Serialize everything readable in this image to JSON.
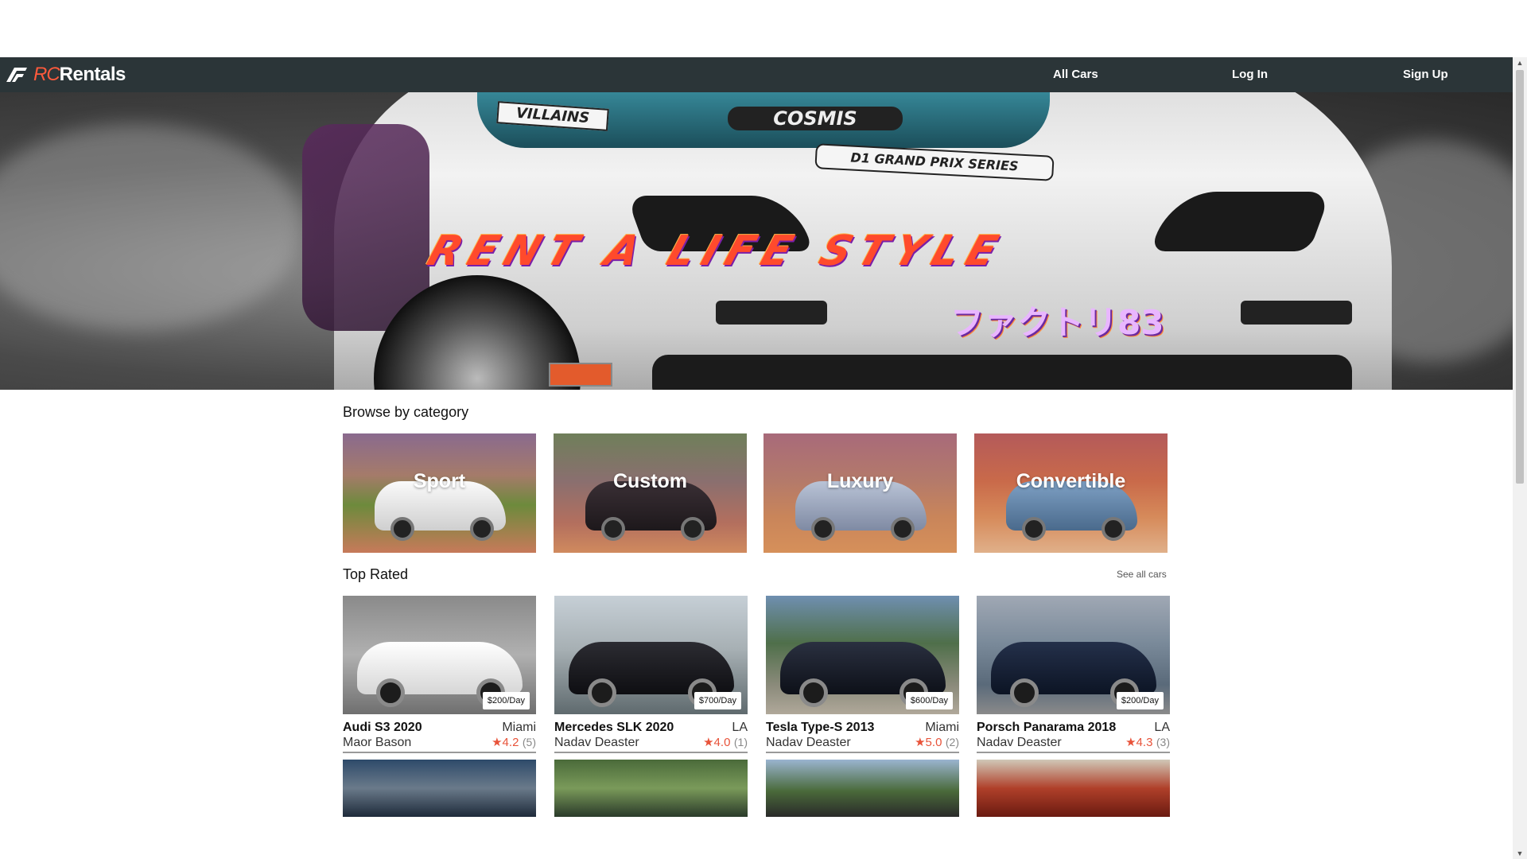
{
  "navbar": {
    "brand_rc": "RC",
    "brand_rentals": "Rentals",
    "links": [
      "All Cars",
      "Log In",
      "Sign Up"
    ],
    "background": "#2b3538",
    "accent": "#ff5a3c"
  },
  "hero": {
    "slogan": "RENT A LIFE STYLE",
    "decals": [
      "VILLAINS",
      "COSMIS",
      "D1 GRAND PRIX SERIES"
    ],
    "japanese_text": "ファクトリ83"
  },
  "browse": {
    "title": "Browse by category",
    "categories": [
      {
        "label": "Sport",
        "icon": "sport-car-photo"
      },
      {
        "label": "Custom",
        "icon": "custom-car-photo"
      },
      {
        "label": "Luxury",
        "icon": "luxury-car-photo"
      },
      {
        "label": "Convertible",
        "icon": "convertible-car-photo"
      }
    ]
  },
  "top_rated": {
    "title": "Top Rated",
    "see_all": "See all cars",
    "cars": [
      {
        "name": "Audi S3 2020",
        "city": "Miami",
        "owner": "Maor Bason",
        "rating": "★4.2",
        "count": "(5)",
        "price": "$200/Day"
      },
      {
        "name": "Mercedes SLK 2020",
        "city": "LA",
        "owner": "Nadav Deaster",
        "rating": "★4.0",
        "count": "(1)",
        "price": "$700/Day"
      },
      {
        "name": "Tesla Type-S 2013",
        "city": "Miami",
        "owner": "Nadav Deaster",
        "rating": "★5.0",
        "count": "(2)",
        "price": "$600/Day"
      },
      {
        "name": "Porsch Panarama 2018",
        "city": "LA",
        "owner": "Nadav Deaster",
        "rating": "★4.3",
        "count": "(3)",
        "price": "$200/Day"
      }
    ]
  },
  "colors": {
    "rating": "#e8533a",
    "page_background": "#ffffff"
  }
}
